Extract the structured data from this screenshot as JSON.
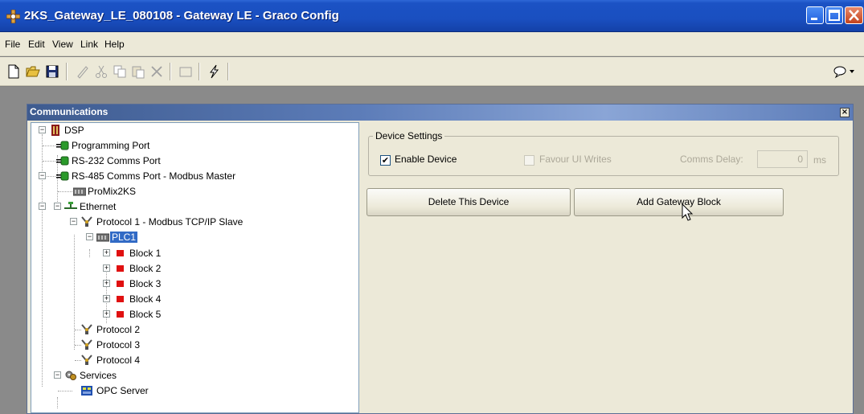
{
  "window": {
    "title": "2KS_Gateway_LE_080108 - Gateway LE - Graco Config"
  },
  "menu": [
    "File",
    "Edit",
    "View",
    "Link",
    "Help"
  ],
  "toolbar": {
    "buttons": [
      "new-icon",
      "open-icon",
      "save-icon",
      "edit-icon",
      "cut-icon",
      "copy-icon",
      "paste-icon",
      "delete-icon",
      "window-icon",
      "lightning-icon"
    ],
    "right_icon": "comment-dropdown-icon"
  },
  "child_window": {
    "title": "Communications"
  },
  "tree": {
    "dsp": "DSP",
    "programming_port": "Programming Port",
    "rs232": "RS-232 Comms Port",
    "rs485": "RS-485 Comms Port - Modbus Master",
    "promix": "ProMix2KS",
    "ethernet": "Ethernet",
    "protocol1": "Protocol 1 - Modbus TCP/IP Slave",
    "plc1": "PLC1",
    "blocks": [
      "Block 1",
      "Block 2",
      "Block 3",
      "Block 4",
      "Block 5"
    ],
    "protocol2": "Protocol 2",
    "protocol3": "Protocol 3",
    "protocol4": "Protocol 4",
    "services": "Services",
    "opc_server": "OPC Server"
  },
  "device_settings": {
    "group_title": "Device Settings",
    "enable_device": "Enable Device",
    "enable_device_checked": true,
    "favour_ui_writes": "Favour UI Writes",
    "favour_ui_writes_checked": false,
    "comms_delay_label": "Comms Delay:",
    "comms_delay_value": "0",
    "comms_delay_unit": "ms"
  },
  "buttons": {
    "delete_device": "Delete This Device",
    "add_gateway_block": "Add Gateway Block"
  },
  "colors": {
    "titlebar": "#1b52c4",
    "block_icon": "#e01010",
    "selection": "#316ac5"
  }
}
